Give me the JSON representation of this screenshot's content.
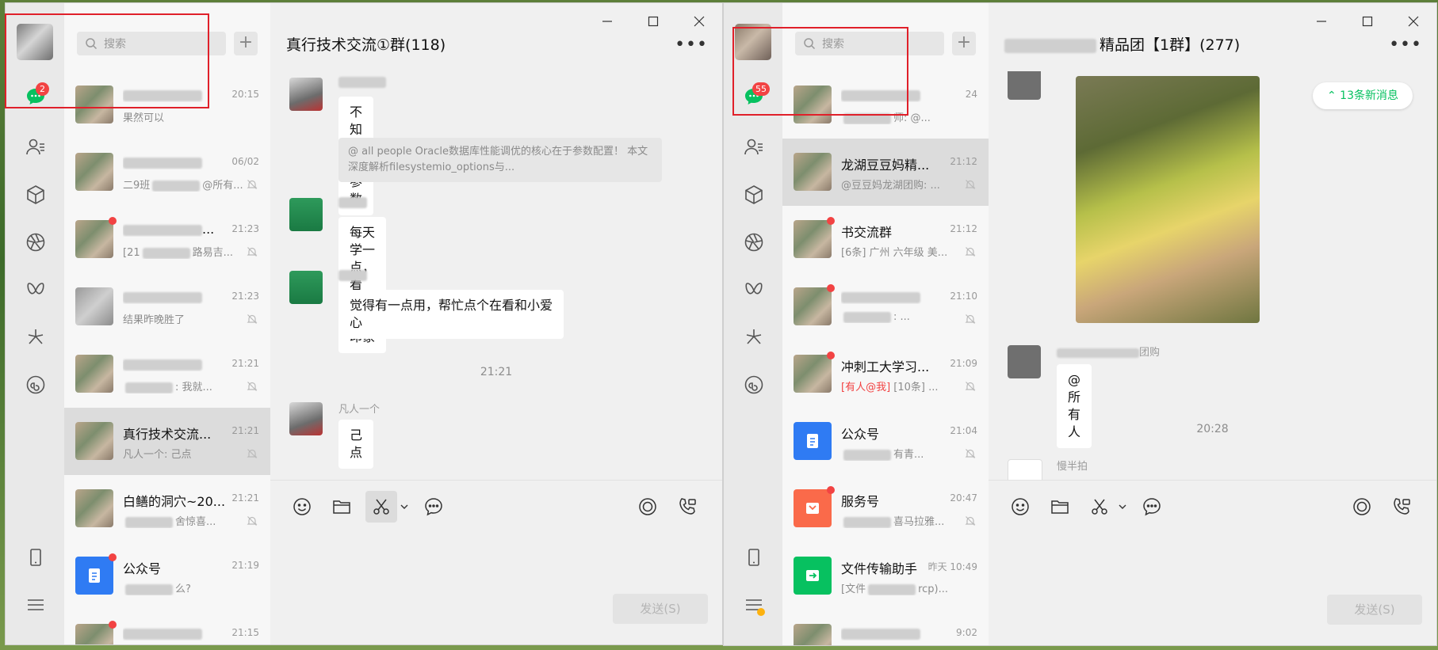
{
  "left": {
    "search_placeholder": "搜索",
    "plus": "+",
    "chat_badge": "2",
    "chats": [
      {
        "name": "",
        "time": "20:15",
        "sub": "果然可以",
        "style": "photo"
      },
      {
        "name": "",
        "time": "06/02",
        "sub": "二9班",
        "sub_tail": "@所有...",
        "style": "photo"
      },
      {
        "name": "...",
        "time": "21:23",
        "sub": "[21",
        "sub_tail": "路易吉...",
        "style": "photo",
        "dot": true
      },
      {
        "name": "",
        "time": "21:23",
        "sub": "结果昨晚胜了",
        "style": "gray"
      },
      {
        "name": "",
        "time": "21:21",
        "sub": "",
        "sub_tail": ": 我就...",
        "style": "photo"
      },
      {
        "name": "真行技术交流...",
        "time": "21:21",
        "sub": "凡人一个: 己点",
        "style": "photo",
        "selected": true
      },
      {
        "name": "白鳝的洞穴~20...",
        "time": "21:21",
        "sub": "",
        "sub_tail": "舍惊喜...",
        "style": "photo"
      },
      {
        "name": "公众号",
        "time": "21:19",
        "sub": "",
        "sub_tail": "么?",
        "style": "blue",
        "dot": true
      },
      {
        "name": "",
        "time": "21:15",
        "sub": "",
        "style": "photo",
        "dot": true
      }
    ],
    "chat_title": "真行技术交流①群(118)",
    "messages": {
      "m1_text": "不知道此参数",
      "m1_quote": "@ all people  Oracle数据库性能调优的核心在于参数配置！ 本文深度解析filesystemio_options与...",
      "m2_text": "每天学一点，看看，留个印象",
      "m3_text": "觉得有一点用，帮忙点个在看和小爱心",
      "timestamp": "21:21",
      "m4_sender": "凡人一个",
      "m4_text": "己点"
    },
    "send": "发送(S)"
  },
  "right": {
    "search_placeholder": "搜索",
    "plus": "+",
    "chat_badge": "55",
    "chats": [
      {
        "name": "",
        "time": "24",
        "sub": "",
        "sub_tail": "师: @...",
        "style": "photo"
      },
      {
        "name": "龙湖豆豆妈精...",
        "time": "21:12",
        "sub": "@豆豆妈龙湖团购: ...",
        "style": "photo",
        "selected": true
      },
      {
        "name": "书交流群",
        "time": "21:12",
        "sub": "[6条] 广州 六年级 美...",
        "style": "photo",
        "dot": true
      },
      {
        "name": "",
        "time": "21:10",
        "sub": "",
        "sub_tail": ": ...",
        "style": "photo",
        "dot": true
      },
      {
        "name": "冲刺工大学习...",
        "time": "21:09",
        "sub_red": "[有人@我]",
        "sub": " [10条] ...",
        "style": "photo",
        "dot": true
      },
      {
        "name": "公众号",
        "time": "21:04",
        "sub": "",
        "sub_tail": "有青...",
        "style": "blue"
      },
      {
        "name": "服务号",
        "time": "20:47",
        "sub": "",
        "sub_tail": "喜马拉雅...",
        "style": "orange",
        "dot": true
      },
      {
        "name": "文件传输助手",
        "time": "昨天 10:49",
        "sub": "[文件",
        "sub_tail": "rcp)...",
        "style": "green"
      },
      {
        "name": "",
        "time": "9:02",
        "sub": "",
        "sub_tail": "...",
        "style": "photo"
      }
    ],
    "chat_title_suffix": "精品团【1群】(277)",
    "new_msgs": "13条新消息",
    "m1_sender": "团购",
    "m1_text": "@所有人",
    "timestamp": "20:28",
    "m2_sender": "慢半拍",
    "send": "发送(S)"
  }
}
